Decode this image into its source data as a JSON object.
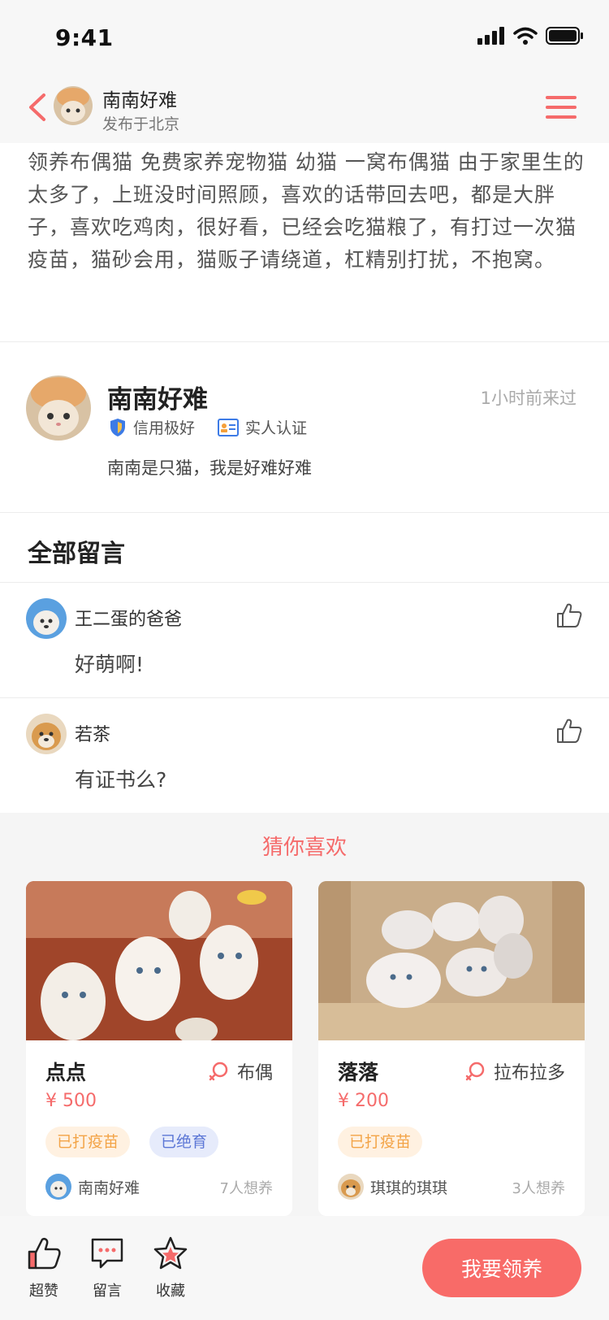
{
  "status_bar": {
    "time": "9:41"
  },
  "nav": {
    "name": "南南好难",
    "subtitle": "发布于北京"
  },
  "description": "领养布偶猫 免费家养宠物猫 幼猫 一窝布偶猫 由于家里生的太多了，上班没时间照顾，喜欢的话带回去吧，都是大胖子，喜欢吃鸡肉，很好看，已经会吃猫粮了，有打过一次猫疫苗，猫砂会用，猫贩子请绕道，杠精别打扰，不抱窝。",
  "publisher": {
    "name": "南南好难",
    "last_seen": "1小时前来过",
    "badges": [
      "信用极好",
      "实人认证"
    ],
    "bio": "南南是只猫，我是好难好难"
  },
  "comments": {
    "title": "全部留言",
    "items": [
      {
        "name": "王二蛋的爸爸",
        "text": "好萌啊!"
      },
      {
        "name": "若茶",
        "text": "有证书么?"
      }
    ]
  },
  "recommend": {
    "title": "猜你喜欢",
    "cards": [
      {
        "name": "点点",
        "breed": "布偶",
        "price": "¥ 500",
        "tags": [
          "已打疫苗",
          "已绝育"
        ],
        "owner": "南南好难",
        "want": "7人想养"
      },
      {
        "name": "落落",
        "breed": "拉布拉多",
        "price": "¥ 200",
        "tags": [
          "已打疫苗"
        ],
        "owner": "琪琪的琪琪",
        "want": "3人想养"
      }
    ]
  },
  "bottom_bar": {
    "actions": [
      "超赞",
      "留言",
      "收藏"
    ],
    "adopt_label": "我要领养"
  },
  "colors": {
    "accent": "#f86b68",
    "tag_orange_bg": "#fff1e1",
    "tag_orange_text": "#f3a447",
    "tag_blue_bg": "#e6ebfb",
    "tag_blue_text": "#5c77d6"
  }
}
